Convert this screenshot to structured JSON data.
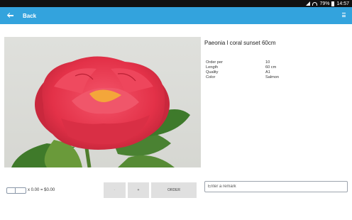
{
  "status_bar": {
    "battery": "79%",
    "time": "14:57"
  },
  "app_bar": {
    "back_label": "Back"
  },
  "product": {
    "title": "Paeonia l coral sunset 60cm",
    "details": [
      {
        "label": "Order per",
        "value": "10"
      },
      {
        "label": "Length",
        "value": "60 cm"
      },
      {
        "label": "Quality",
        "value": "A1"
      },
      {
        "label": "Color",
        "value": "Salmon"
      }
    ]
  },
  "order": {
    "summary": "x 0.00 = $0.00",
    "minus_label": "-",
    "plus_label": "+",
    "order_label": "ORDER",
    "remark_placeholder": "Enter a remark"
  },
  "colors": {
    "app_bar": "#33a3dd",
    "flower": "#e8384f"
  }
}
